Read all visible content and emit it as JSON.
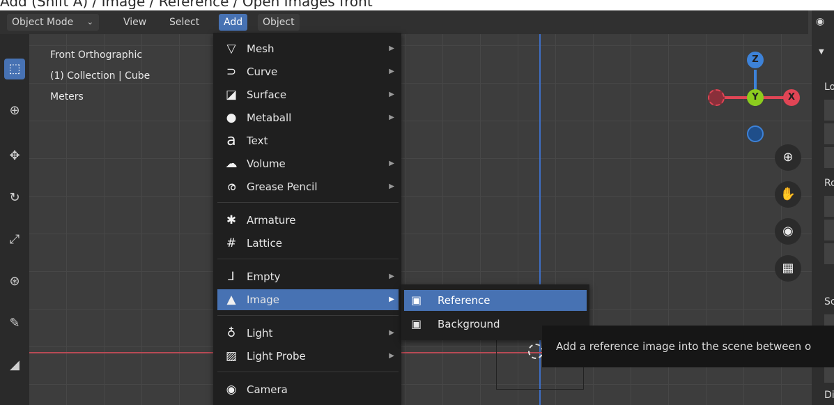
{
  "caption": "Add (Shift A) / Image / Reference / Open Images front",
  "header": {
    "mode": "Object Mode",
    "menus": [
      "View",
      "Select",
      "Add",
      "Object"
    ]
  },
  "overlay": {
    "view_name": "Front Orthographic",
    "collection": "(1) Collection | Cube",
    "units": "Meters"
  },
  "add_menu": {
    "items": [
      {
        "label": "Mesh",
        "icon": "mesh-icon",
        "glyph": "▽",
        "submenu": true
      },
      {
        "label": "Curve",
        "icon": "curve-icon",
        "glyph": "⊃",
        "submenu": true
      },
      {
        "label": "Surface",
        "icon": "surface-icon",
        "glyph": "◪",
        "submenu": true
      },
      {
        "label": "Metaball",
        "icon": "metaball-icon",
        "glyph": "●",
        "submenu": true
      },
      {
        "label": "Text",
        "icon": "text-icon",
        "glyph": "a",
        "submenu": false
      },
      {
        "label": "Volume",
        "icon": "volume-icon",
        "glyph": "☁",
        "submenu": true
      },
      {
        "label": "Grease Pencil",
        "icon": "grease-pencil-icon",
        "glyph": "ര",
        "submenu": true
      },
      {
        "label": "Armature",
        "icon": "armature-icon",
        "glyph": "✱",
        "submenu": false
      },
      {
        "label": "Lattice",
        "icon": "lattice-icon",
        "glyph": "#",
        "submenu": false
      },
      {
        "label": "Empty",
        "icon": "empty-icon",
        "glyph": "⅃",
        "submenu": true
      },
      {
        "label": "Image",
        "icon": "image-icon",
        "glyph": "▲",
        "submenu": true,
        "highlighted": true
      },
      {
        "label": "Light",
        "icon": "light-icon",
        "glyph": "♁",
        "submenu": true
      },
      {
        "label": "Light Probe",
        "icon": "light-probe-icon",
        "glyph": "▨",
        "submenu": true
      },
      {
        "label": "Camera",
        "icon": "camera-icon",
        "glyph": "◉",
        "submenu": false
      }
    ]
  },
  "image_submenu": {
    "items": [
      {
        "label": "Reference",
        "icon": "reference-image-icon",
        "glyph": "▣",
        "highlighted": true
      },
      {
        "label": "Background",
        "icon": "background-image-icon",
        "glyph": "▣"
      }
    ]
  },
  "tooltip": "Add a reference image into the scene between o",
  "gizmo": {
    "z": "Z",
    "y": "Y",
    "x": "X"
  },
  "npanel": {
    "labels": [
      "Lo",
      "Ro",
      "Sc",
      "Di"
    ]
  },
  "colors": {
    "accent": "#4772b3",
    "x_axis": "#e04555",
    "y_axis": "#8ccc1e",
    "z_axis": "#3d82d8"
  }
}
